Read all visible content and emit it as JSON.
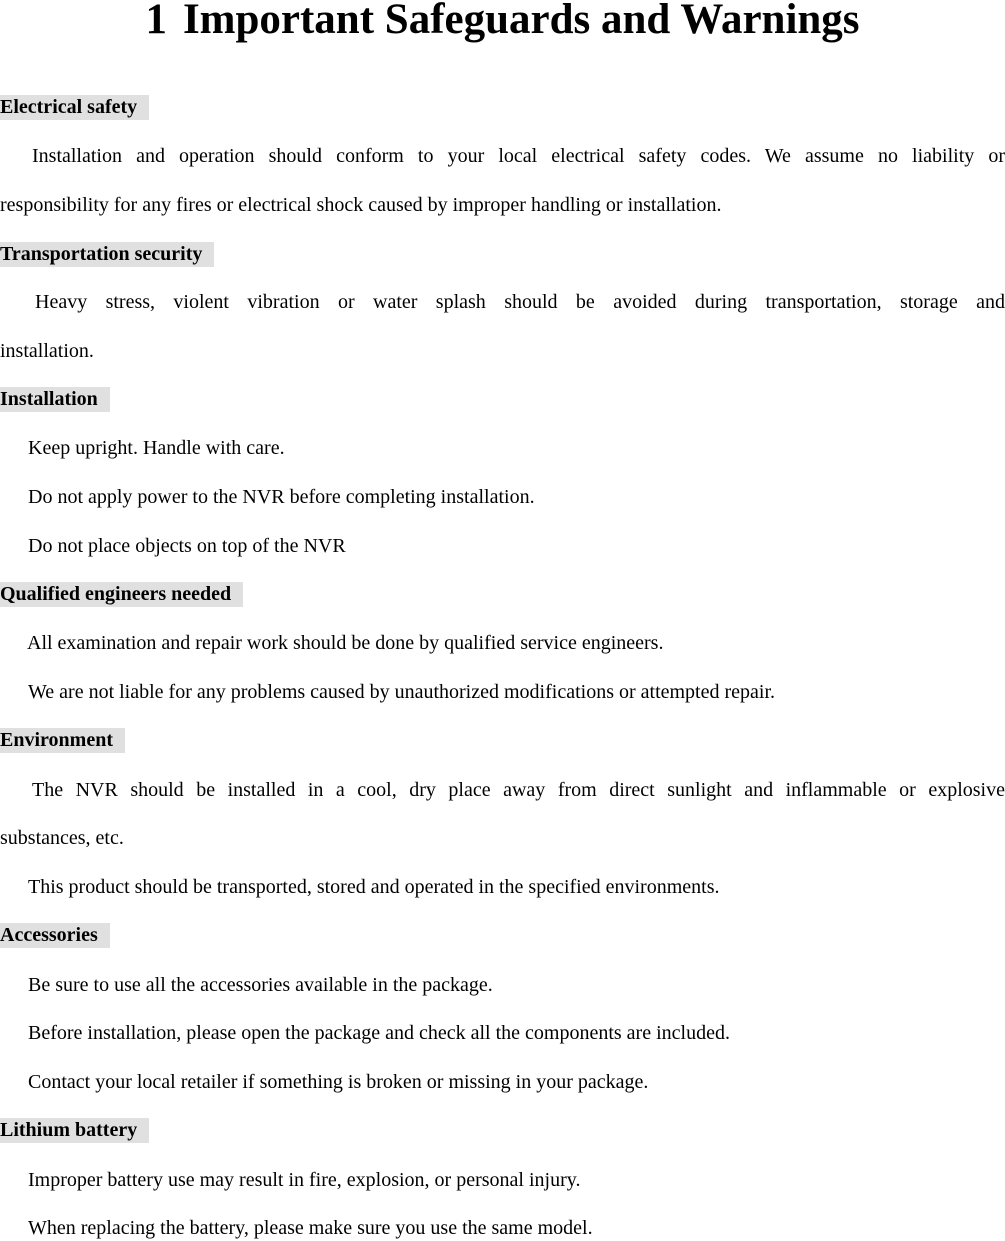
{
  "document": {
    "title_number": "1",
    "title": "Important Safeguards and Warnings",
    "sections": [
      {
        "heading": "Electrical safety",
        "lines": [
          "Installation and operation should conform to your local electrical safety codes. We assume no liability or",
          "responsibility for any fires or electrical shock caused by improper handling or installation."
        ]
      },
      {
        "heading": "Transportation security",
        "lines": [
          "Heavy stress, violent vibration or water splash should be avoided during transportation, storage and",
          "installation."
        ]
      },
      {
        "heading": "Installation",
        "lines": [
          "Keep upright. Handle with care.",
          "Do not apply power to the NVR before completing installation.",
          "Do not place objects on top of the NVR"
        ]
      },
      {
        "heading": "Qualified engineers needed",
        "lines": [
          "All examination and repair work should be done by qualified service engineers.",
          "We are not liable for any problems caused by unauthorized modifications or attempted repair."
        ]
      },
      {
        "heading": "Environment",
        "lines": [
          "The NVR should be installed in a cool, dry place away from direct sunlight and inflammable or explosive",
          "substances, etc.",
          "This product should be transported, stored and operated in the specified environments."
        ]
      },
      {
        "heading": "Accessories",
        "lines": [
          "Be sure to use all the accessories available in the package.",
          "Before installation, please open the package and check all the components are included.",
          "Contact your local retailer if something is broken or missing in your package."
        ]
      },
      {
        "heading": "Lithium battery",
        "lines": [
          "Improper battery use may result in fire, explosion, or personal injury.",
          "When replacing the battery, please make sure you use the same model."
        ]
      }
    ]
  },
  "colors": {
    "heading_background": "#e0e0e0",
    "text": "#000000"
  }
}
